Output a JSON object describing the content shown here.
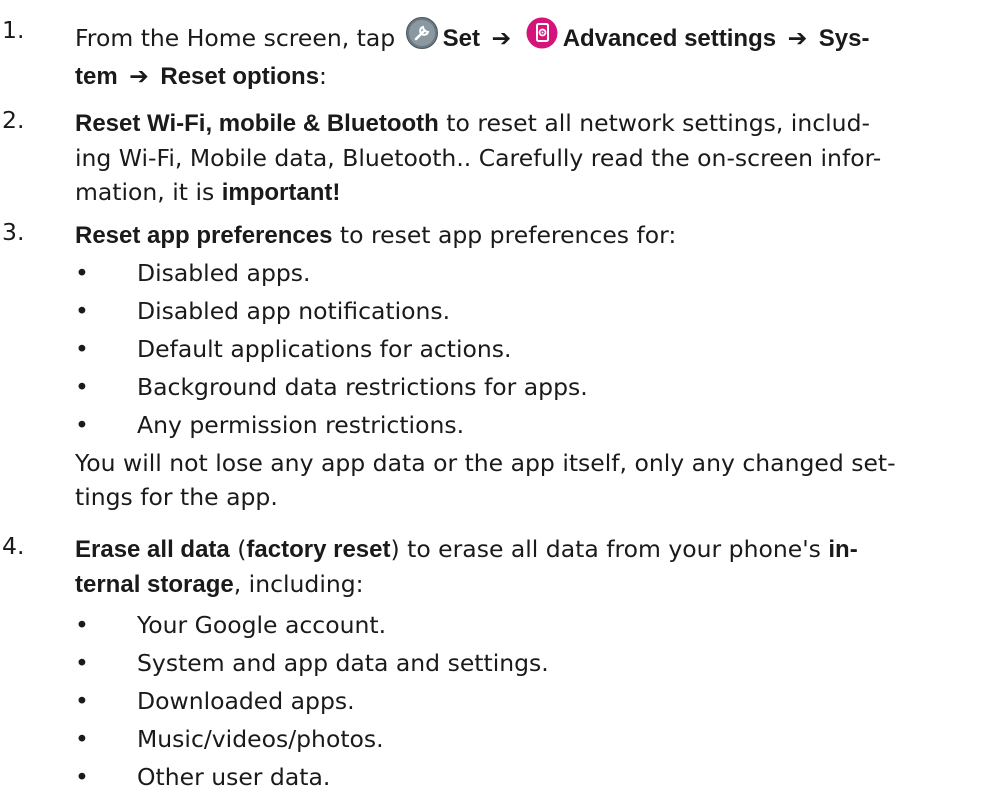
{
  "steps": [
    {
      "num": "1.",
      "prefix": "From the Home screen, tap",
      "set_label": "Set",
      "advanced_label": "Advanced settings",
      "system_label1": "Sys-",
      "system_label2": "tem",
      "reset_label": "Reset options",
      "suffix": ":"
    },
    {
      "num": "2.",
      "bold1": "Reset Wi-Fi, mobile & Bluetooth",
      "text1": " to reset all network settings, includ-",
      "line2": "ing Wi-Fi, Mobile data, Bluetooth.. Carefully read the on-screen infor-",
      "line3a": "mation, it is ",
      "bold2": "important!"
    },
    {
      "num": "3.",
      "bold1": "Reset app preferences",
      "text1": " to reset app preferences for:",
      "bullets": [
        "Disabled apps.",
        "Disabled app notifications.",
        "Default applications for actions.",
        "Background data restrictions for apps.",
        "Any permission restrictions."
      ],
      "note1": "You will not lose any app data or the app itself, only any changed set-",
      "note2": "tings for the app."
    },
    {
      "num": "4.",
      "bold1": "Erase all data",
      "text1": " (",
      "bold2": "factory reset",
      "text2": ") to erase all data from your phone's ",
      "bold3a": "in-",
      "bold3b": "ternal storage",
      "text3": ", including:",
      "bullets": [
        "Your Google account.",
        "System and app data and settings.",
        "Downloaded apps.",
        "Music/videos/photos.",
        "Other user data."
      ]
    }
  ],
  "bullet_char": "•",
  "arrow_char": "➔",
  "icons": {
    "set": "wrench-icon",
    "advanced": "phone-settings-icon"
  },
  "colors": {
    "text": "#1a1a1a",
    "set_icon_fill": "#6b7a82",
    "advanced_icon_fill": "#d4147a"
  }
}
